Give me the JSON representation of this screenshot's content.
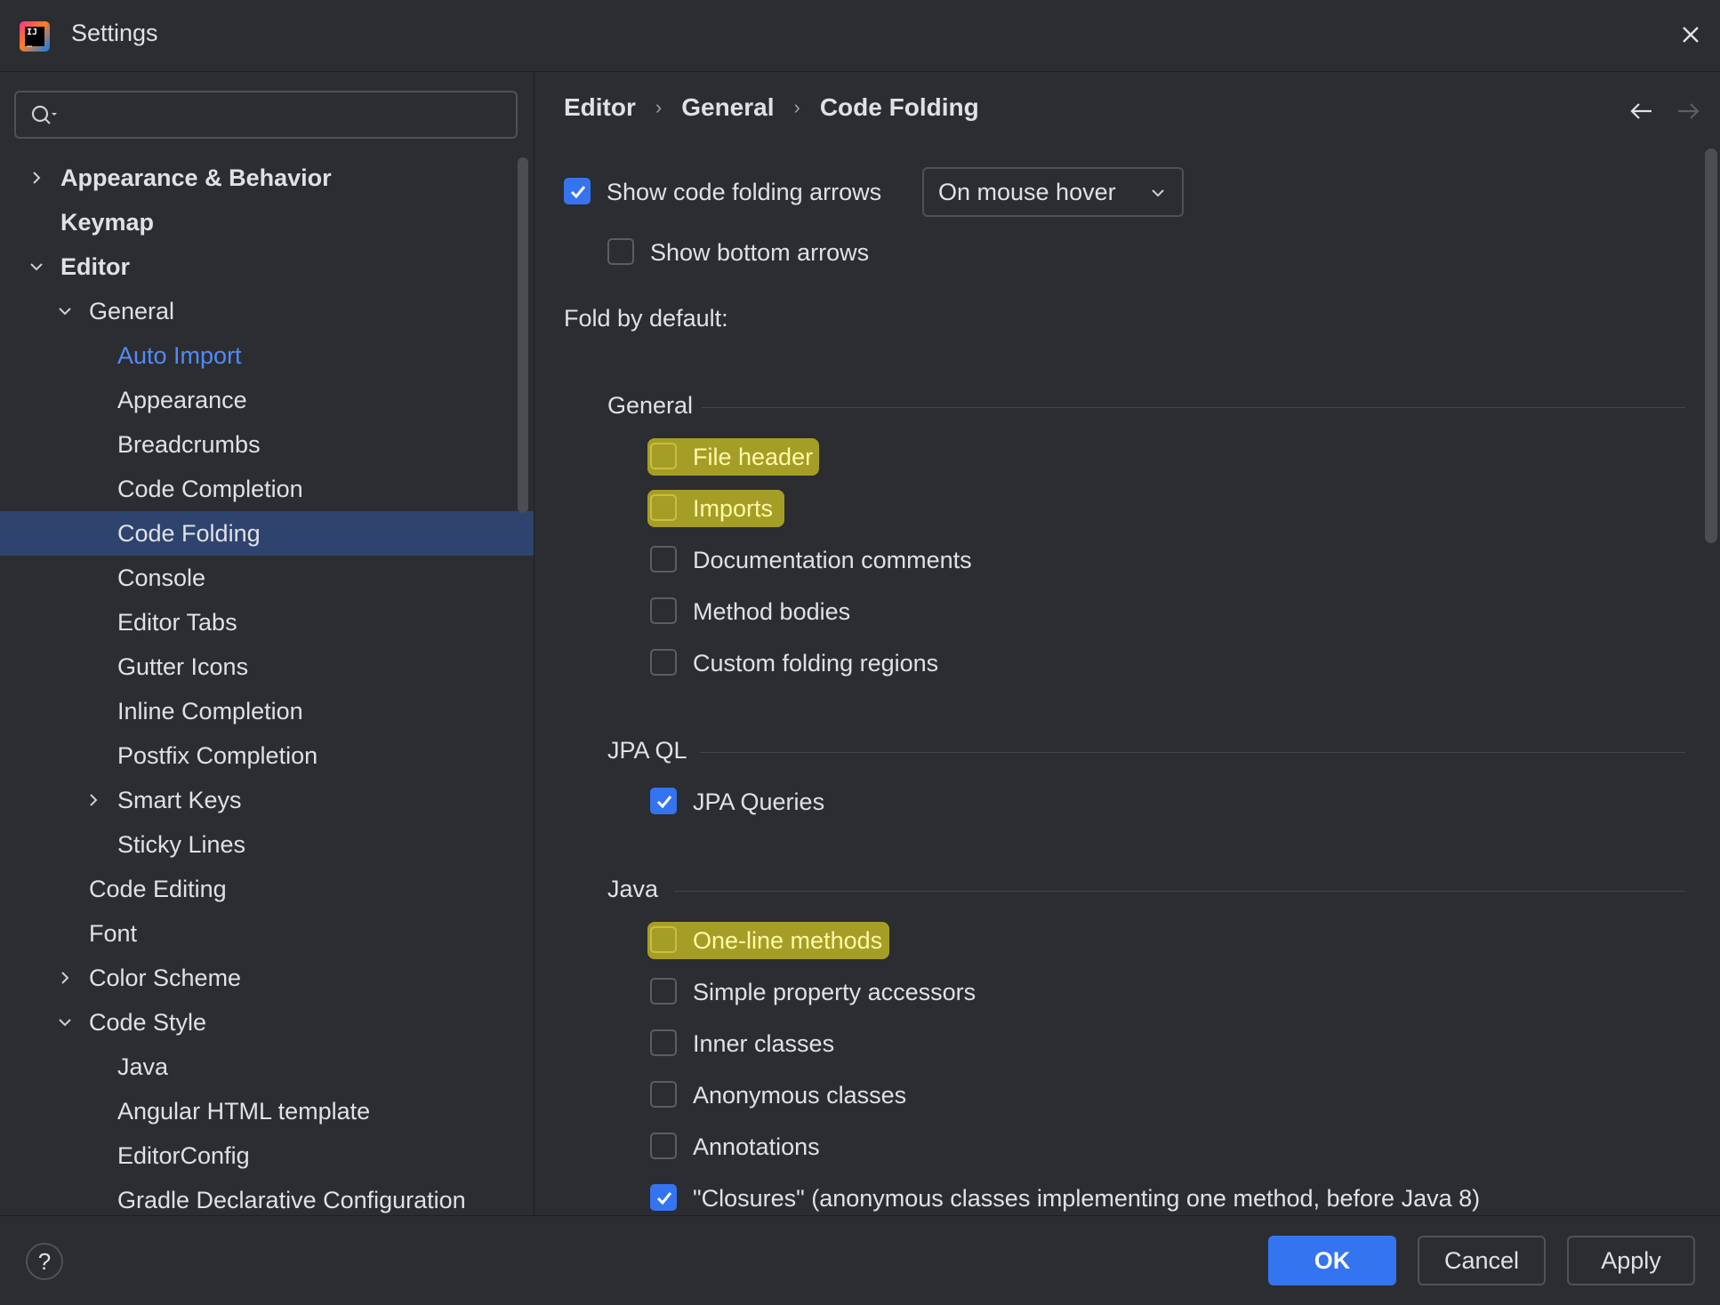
{
  "window": {
    "title": "Settings"
  },
  "search": {
    "placeholder": "",
    "value": ""
  },
  "sidebar": {
    "items": [
      {
        "label": "Appearance & Behavior"
      },
      {
        "label": "Keymap"
      },
      {
        "label": "Editor"
      },
      {
        "label": "General"
      },
      {
        "label": "Auto Import"
      },
      {
        "label": "Appearance"
      },
      {
        "label": "Breadcrumbs"
      },
      {
        "label": "Code Completion"
      },
      {
        "label": "Code Folding"
      },
      {
        "label": "Console"
      },
      {
        "label": "Editor Tabs"
      },
      {
        "label": "Gutter Icons"
      },
      {
        "label": "Inline Completion"
      },
      {
        "label": "Postfix Completion"
      },
      {
        "label": "Smart Keys"
      },
      {
        "label": "Sticky Lines"
      },
      {
        "label": "Code Editing"
      },
      {
        "label": "Font"
      },
      {
        "label": "Color Scheme"
      },
      {
        "label": "Code Style"
      },
      {
        "label": "Java"
      },
      {
        "label": "Angular HTML template"
      },
      {
        "label": "EditorConfig"
      },
      {
        "label": "Gradle Declarative Configuration"
      }
    ],
    "selected": "Code Folding"
  },
  "breadcrumb": [
    "Editor",
    "General",
    "Code Folding"
  ],
  "folding": {
    "show_arrows": {
      "label": "Show code folding arrows",
      "checked": true
    },
    "arrows_mode": {
      "value": "On mouse hover"
    },
    "show_bottom_arrows": {
      "label": "Show bottom arrows",
      "checked": false
    },
    "fold_by_default_label": "Fold by default:"
  },
  "groups": {
    "general": {
      "title": "General",
      "items": [
        {
          "label": "File header",
          "checked": false,
          "highlighted": true
        },
        {
          "label": "Imports",
          "checked": false,
          "highlighted": true
        },
        {
          "label": "Documentation comments",
          "checked": false
        },
        {
          "label": "Method bodies",
          "checked": false
        },
        {
          "label": "Custom folding regions",
          "checked": false
        }
      ]
    },
    "jpaql": {
      "title": "JPA QL",
      "items": [
        {
          "label": "JPA Queries",
          "checked": true
        }
      ]
    },
    "java": {
      "title": "Java",
      "items": [
        {
          "label": "One-line methods",
          "checked": false,
          "highlighted": true
        },
        {
          "label": "Simple property accessors",
          "checked": false
        },
        {
          "label": "Inner classes",
          "checked": false
        },
        {
          "label": "Anonymous classes",
          "checked": false
        },
        {
          "label": "Annotations",
          "checked": false
        },
        {
          "label": "\"Closures\" (anonymous classes implementing one method, before Java 8)",
          "checked": true
        }
      ]
    }
  },
  "footer": {
    "help": "?",
    "ok": "OK",
    "cancel": "Cancel",
    "apply": "Apply"
  },
  "colors": {
    "accent": "#3574f0",
    "selection": "#2e436e",
    "search_highlight": "#a59e26",
    "link": "#548af7"
  }
}
